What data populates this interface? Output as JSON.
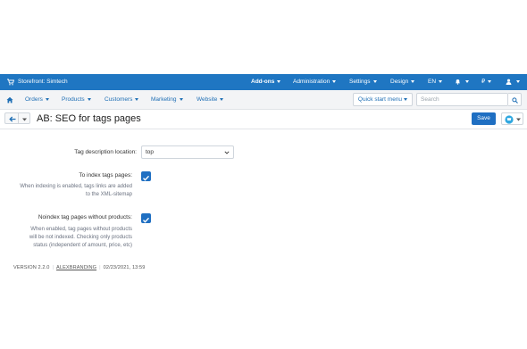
{
  "topbar": {
    "storefront": "Storefront: Simtech",
    "menus": [
      "Add-ons",
      "Administration",
      "Settings",
      "Design",
      "EN",
      "₽"
    ]
  },
  "navbar": {
    "items": [
      "Orders",
      "Products",
      "Customers",
      "Marketing",
      "Website"
    ],
    "quick_start": "Quick start menu",
    "search_placeholder": "Search"
  },
  "page": {
    "title": "AB: SEO for tags pages",
    "save": "Save"
  },
  "form": {
    "tag_description_label": "Tag description location:",
    "tag_description_value": "top",
    "index_label": "To index tags pages:",
    "index_help": [
      "When indexing is enabled, tags links are added",
      "to the XML-sitemap"
    ],
    "index_checked": true,
    "noindex_label": "Noindex tag pages without products:",
    "noindex_help": [
      "When enabled, tag pages without products",
      "will be not indexed. Checking only products",
      "status (independent of amount, price, etc)"
    ],
    "noindex_checked": true
  },
  "footer": {
    "version": "VERSION 2.2.0",
    "vendor": "ALEXBRANDING",
    "date": "02/23/2021, 13:59"
  },
  "colors": {
    "topbar": "#1f76c2",
    "accent": "#1f6fc2"
  }
}
